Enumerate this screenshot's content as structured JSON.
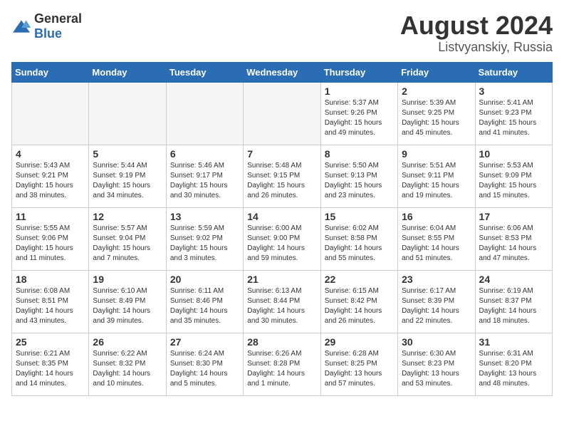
{
  "logo": {
    "general": "General",
    "blue": "Blue"
  },
  "header": {
    "month": "August 2024",
    "location": "Listvyanskiy, Russia"
  },
  "weekdays": [
    "Sunday",
    "Monday",
    "Tuesday",
    "Wednesday",
    "Thursday",
    "Friday",
    "Saturday"
  ],
  "weeks": [
    [
      {
        "day": "",
        "info": "",
        "empty": true
      },
      {
        "day": "",
        "info": "",
        "empty": true
      },
      {
        "day": "",
        "info": "",
        "empty": true
      },
      {
        "day": "",
        "info": "",
        "empty": true
      },
      {
        "day": "1",
        "info": "Sunrise: 5:37 AM\nSunset: 9:26 PM\nDaylight: 15 hours\nand 49 minutes."
      },
      {
        "day": "2",
        "info": "Sunrise: 5:39 AM\nSunset: 9:25 PM\nDaylight: 15 hours\nand 45 minutes."
      },
      {
        "day": "3",
        "info": "Sunrise: 5:41 AM\nSunset: 9:23 PM\nDaylight: 15 hours\nand 41 minutes."
      }
    ],
    [
      {
        "day": "4",
        "info": "Sunrise: 5:43 AM\nSunset: 9:21 PM\nDaylight: 15 hours\nand 38 minutes."
      },
      {
        "day": "5",
        "info": "Sunrise: 5:44 AM\nSunset: 9:19 PM\nDaylight: 15 hours\nand 34 minutes."
      },
      {
        "day": "6",
        "info": "Sunrise: 5:46 AM\nSunset: 9:17 PM\nDaylight: 15 hours\nand 30 minutes."
      },
      {
        "day": "7",
        "info": "Sunrise: 5:48 AM\nSunset: 9:15 PM\nDaylight: 15 hours\nand 26 minutes."
      },
      {
        "day": "8",
        "info": "Sunrise: 5:50 AM\nSunset: 9:13 PM\nDaylight: 15 hours\nand 23 minutes."
      },
      {
        "day": "9",
        "info": "Sunrise: 5:51 AM\nSunset: 9:11 PM\nDaylight: 15 hours\nand 19 minutes."
      },
      {
        "day": "10",
        "info": "Sunrise: 5:53 AM\nSunset: 9:09 PM\nDaylight: 15 hours\nand 15 minutes."
      }
    ],
    [
      {
        "day": "11",
        "info": "Sunrise: 5:55 AM\nSunset: 9:06 PM\nDaylight: 15 hours\nand 11 minutes."
      },
      {
        "day": "12",
        "info": "Sunrise: 5:57 AM\nSunset: 9:04 PM\nDaylight: 15 hours\nand 7 minutes."
      },
      {
        "day": "13",
        "info": "Sunrise: 5:59 AM\nSunset: 9:02 PM\nDaylight: 15 hours\nand 3 minutes."
      },
      {
        "day": "14",
        "info": "Sunrise: 6:00 AM\nSunset: 9:00 PM\nDaylight: 14 hours\nand 59 minutes."
      },
      {
        "day": "15",
        "info": "Sunrise: 6:02 AM\nSunset: 8:58 PM\nDaylight: 14 hours\nand 55 minutes."
      },
      {
        "day": "16",
        "info": "Sunrise: 6:04 AM\nSunset: 8:55 PM\nDaylight: 14 hours\nand 51 minutes."
      },
      {
        "day": "17",
        "info": "Sunrise: 6:06 AM\nSunset: 8:53 PM\nDaylight: 14 hours\nand 47 minutes."
      }
    ],
    [
      {
        "day": "18",
        "info": "Sunrise: 6:08 AM\nSunset: 8:51 PM\nDaylight: 14 hours\nand 43 minutes."
      },
      {
        "day": "19",
        "info": "Sunrise: 6:10 AM\nSunset: 8:49 PM\nDaylight: 14 hours\nand 39 minutes."
      },
      {
        "day": "20",
        "info": "Sunrise: 6:11 AM\nSunset: 8:46 PM\nDaylight: 14 hours\nand 35 minutes."
      },
      {
        "day": "21",
        "info": "Sunrise: 6:13 AM\nSunset: 8:44 PM\nDaylight: 14 hours\nand 30 minutes."
      },
      {
        "day": "22",
        "info": "Sunrise: 6:15 AM\nSunset: 8:42 PM\nDaylight: 14 hours\nand 26 minutes."
      },
      {
        "day": "23",
        "info": "Sunrise: 6:17 AM\nSunset: 8:39 PM\nDaylight: 14 hours\nand 22 minutes."
      },
      {
        "day": "24",
        "info": "Sunrise: 6:19 AM\nSunset: 8:37 PM\nDaylight: 14 hours\nand 18 minutes."
      }
    ],
    [
      {
        "day": "25",
        "info": "Sunrise: 6:21 AM\nSunset: 8:35 PM\nDaylight: 14 hours\nand 14 minutes."
      },
      {
        "day": "26",
        "info": "Sunrise: 6:22 AM\nSunset: 8:32 PM\nDaylight: 14 hours\nand 10 minutes."
      },
      {
        "day": "27",
        "info": "Sunrise: 6:24 AM\nSunset: 8:30 PM\nDaylight: 14 hours\nand 5 minutes."
      },
      {
        "day": "28",
        "info": "Sunrise: 6:26 AM\nSunset: 8:28 PM\nDaylight: 14 hours\nand 1 minute."
      },
      {
        "day": "29",
        "info": "Sunrise: 6:28 AM\nSunset: 8:25 PM\nDaylight: 13 hours\nand 57 minutes."
      },
      {
        "day": "30",
        "info": "Sunrise: 6:30 AM\nSunset: 8:23 PM\nDaylight: 13 hours\nand 53 minutes."
      },
      {
        "day": "31",
        "info": "Sunrise: 6:31 AM\nSunset: 8:20 PM\nDaylight: 13 hours\nand 48 minutes."
      }
    ]
  ]
}
